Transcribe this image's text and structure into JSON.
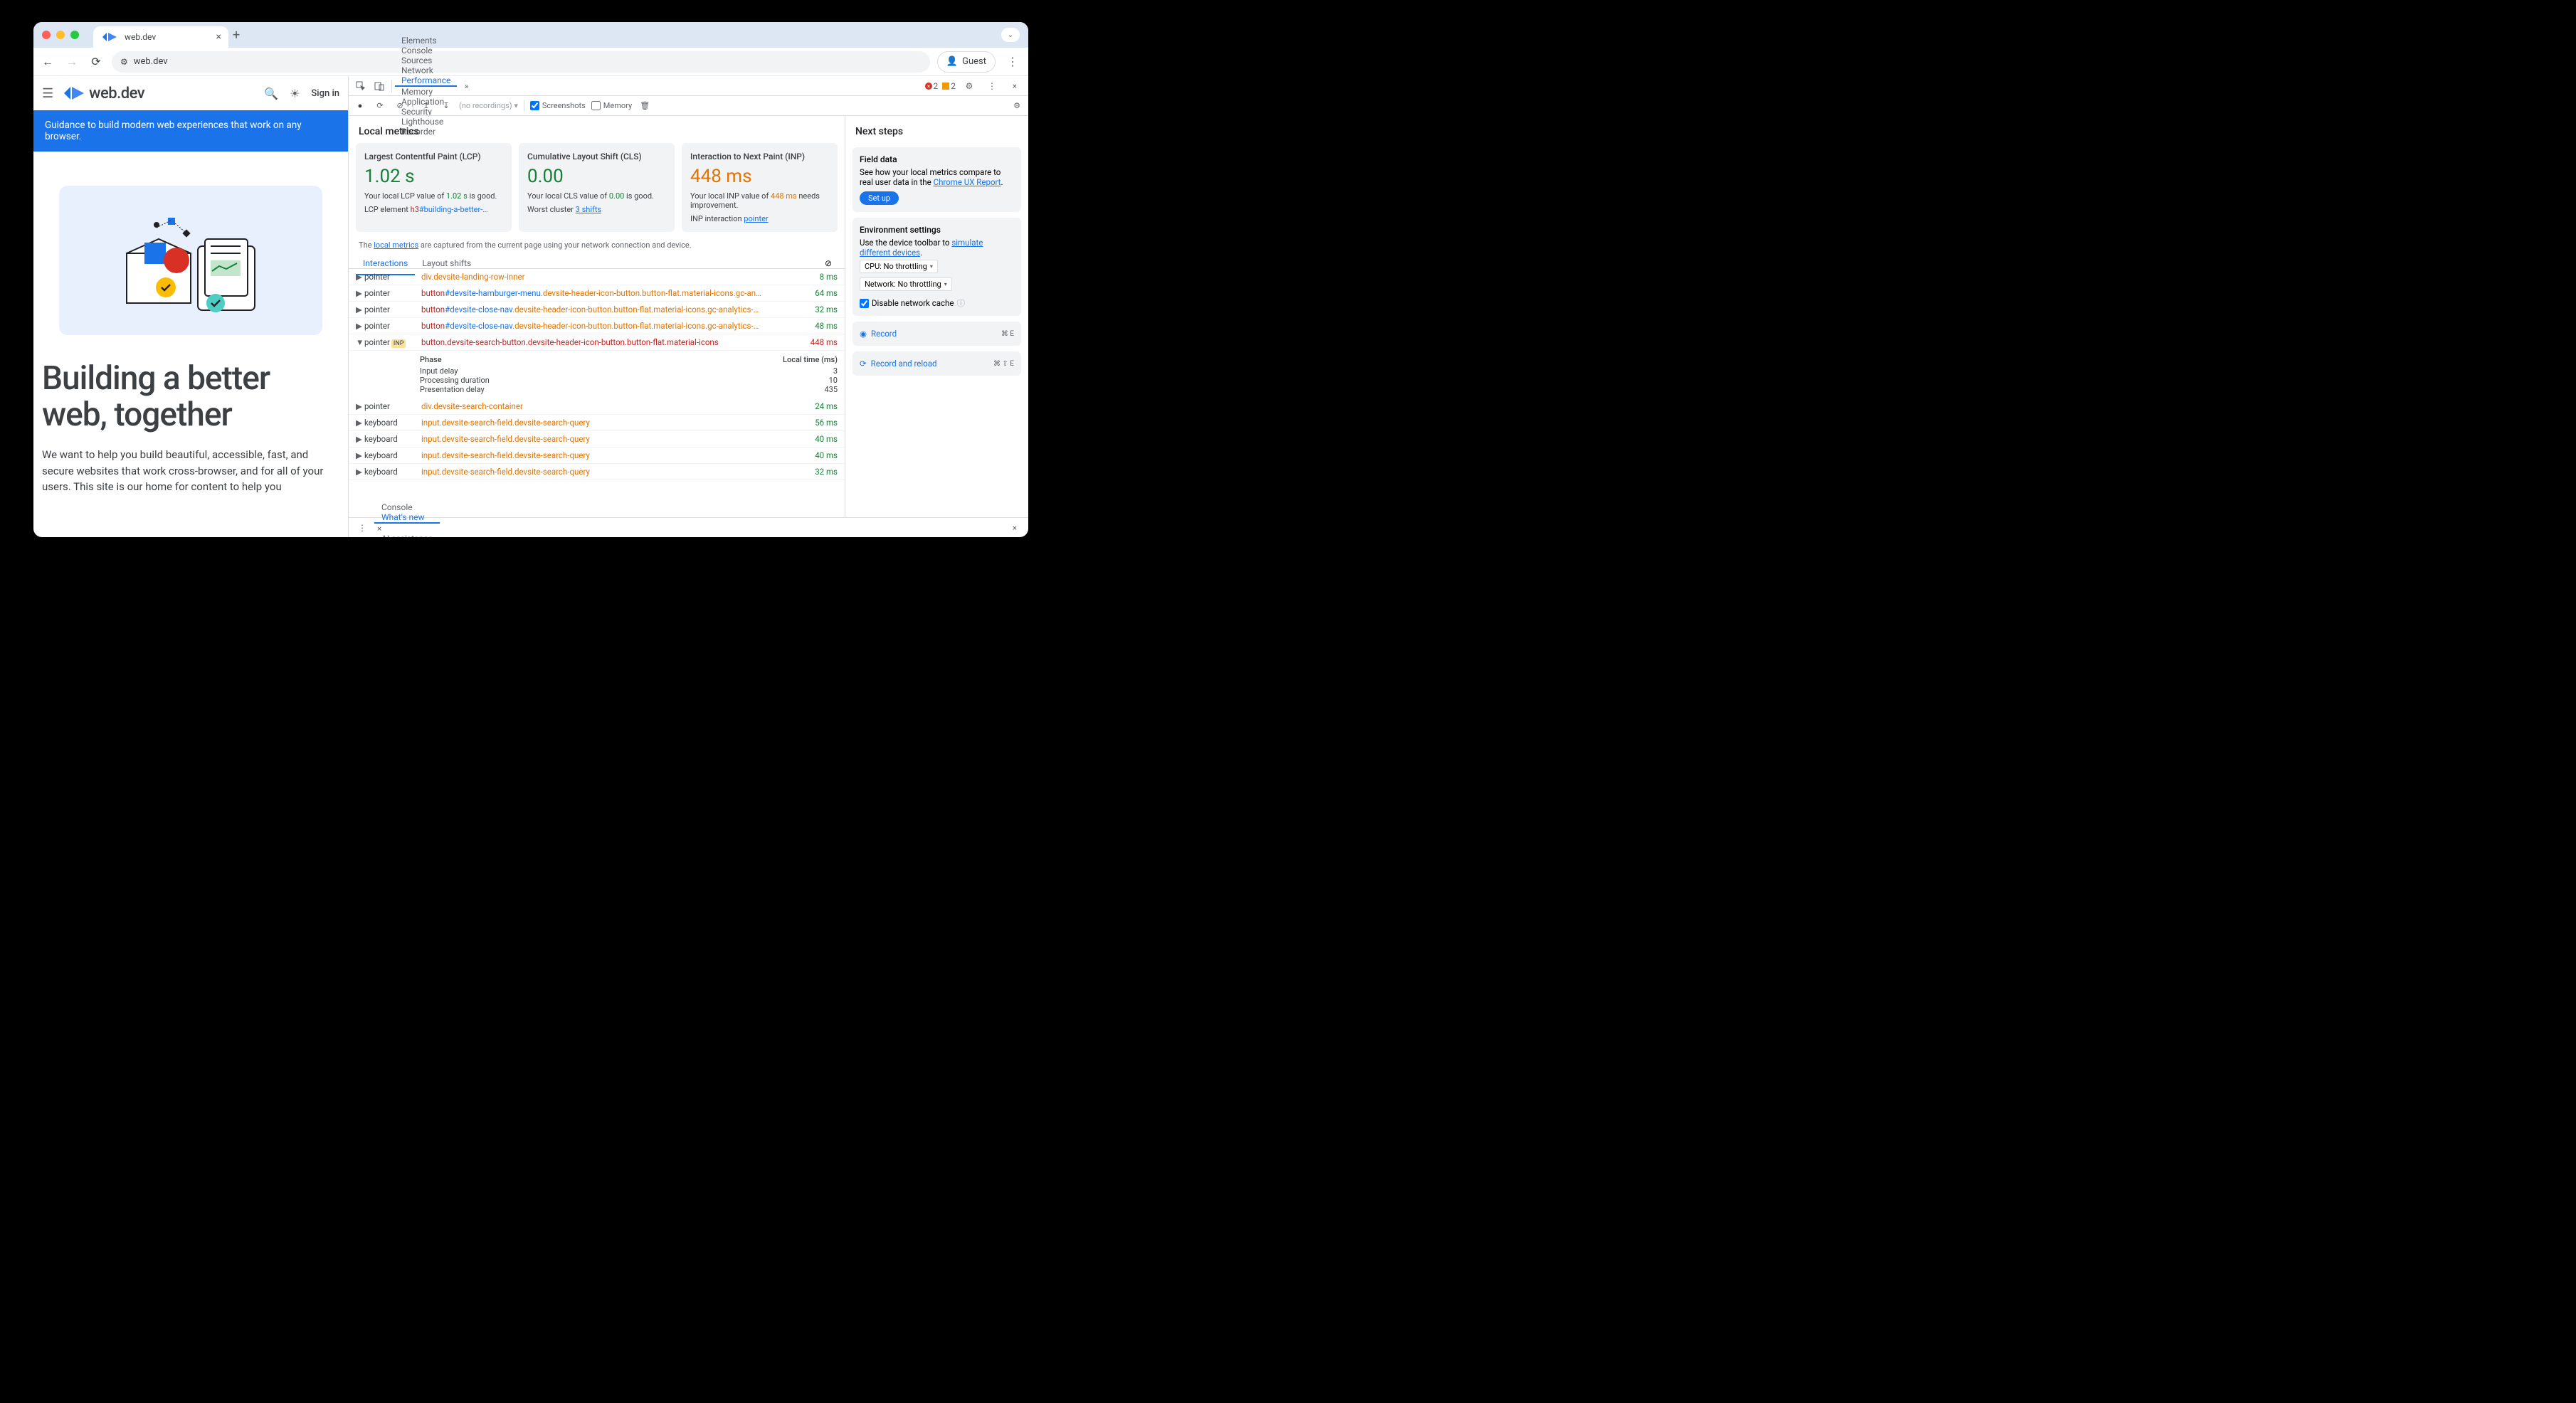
{
  "browser": {
    "tab_title": "web.dev",
    "url": "web.dev",
    "guest_label": "Guest"
  },
  "webdev": {
    "brand": "web.dev",
    "signin": "Sign in",
    "banner": "Guidance to build modern web experiences that work on any browser.",
    "hero_title": "Building a better web, together",
    "hero_body": "We want to help you build beautiful, accessible, fast, and secure websites that work cross-browser, and for all of your users. This site is our home for content to help you"
  },
  "devtools": {
    "tabs": [
      "Elements",
      "Console",
      "Sources",
      "Network",
      "Performance",
      "Memory",
      "Application",
      "Security",
      "Lighthouse",
      "Recorder"
    ],
    "active_tab": "Performance",
    "errors": "2",
    "warnings": "2",
    "toolbar": {
      "recordings": "(no recordings)",
      "screenshots_label": "Screenshots",
      "memory_label": "Memory"
    },
    "local_metrics_title": "Local metrics",
    "metrics": [
      {
        "title": "Largest Contentful Paint (LCP)",
        "value": "1.02 s",
        "cls": "good",
        "desc_pre": "Your local LCP value of ",
        "desc_val": "1.02 s",
        "desc_post": " is good.",
        "extra_label": "LCP element",
        "extra_tag": "h3",
        "extra_sel": "#building-a-better-…"
      },
      {
        "title": "Cumulative Layout Shift (CLS)",
        "value": "0.00",
        "cls": "good",
        "desc_pre": "Your local CLS value of ",
        "desc_val": "0.00",
        "desc_post": " is good.",
        "extra_label": "Worst cluster ",
        "extra_link": "3 shifts"
      },
      {
        "title": "Interaction to Next Paint (INP)",
        "value": "448 ms",
        "cls": "warn",
        "desc_pre": "Your local INP value of ",
        "desc_val": "448 ms",
        "desc_post": " needs improvement.",
        "extra_label": "INP interaction ",
        "extra_link": "pointer"
      }
    ],
    "info_pre": "The ",
    "info_link": "local metrics",
    "info_post": " are captured from the current page using your network connection and device.",
    "subtabs": [
      "Interactions",
      "Layout shifts"
    ],
    "phase": {
      "header_l": "Phase",
      "header_r": "Local time (ms)",
      "rows": [
        {
          "l": "Input delay",
          "r": "3"
        },
        {
          "l": "Processing duration",
          "r": "10"
        },
        {
          "l": "Presentation delay",
          "r": "435"
        }
      ]
    },
    "interactions": [
      {
        "type": "pointer",
        "sel": [
          [
            "cls",
            "div.devsite-landing-row-inner"
          ]
        ],
        "time": "8 ms"
      },
      {
        "type": "pointer",
        "sel": [
          [
            "tag",
            "button"
          ],
          [
            "id",
            "#devsite-hamburger-menu"
          ],
          [
            "cls",
            ".devsite-header-icon-button.button-flat.material-icons.gc-an…"
          ]
        ],
        "time": "64 ms"
      },
      {
        "type": "pointer",
        "sel": [
          [
            "tag",
            "button"
          ],
          [
            "id",
            "#devsite-close-nav"
          ],
          [
            "cls",
            ".devsite-header-icon-button.button-flat.material-icons.gc-analytics-…"
          ]
        ],
        "time": "32 ms"
      },
      {
        "type": "pointer",
        "sel": [
          [
            "tag",
            "button"
          ],
          [
            "id",
            "#devsite-close-nav"
          ],
          [
            "cls",
            ".devsite-header-icon-button.button-flat.material-icons.gc-analytics-…"
          ]
        ],
        "time": "48 ms"
      },
      {
        "type": "pointer",
        "inp": true,
        "expanded": true,
        "sel": [
          [
            "tag",
            "button.devsite-search-button.devsite-header-icon-button.button-flat.material-icons"
          ]
        ],
        "time": "448 ms"
      },
      {
        "type": "pointer",
        "sel": [
          [
            "cls",
            "div.devsite-search-container"
          ]
        ],
        "time": "24 ms"
      },
      {
        "type": "keyboard",
        "sel": [
          [
            "cls",
            "input.devsite-search-field.devsite-search-query"
          ]
        ],
        "time": "56 ms"
      },
      {
        "type": "keyboard",
        "sel": [
          [
            "cls",
            "input.devsite-search-field.devsite-search-query"
          ]
        ],
        "time": "40 ms"
      },
      {
        "type": "keyboard",
        "sel": [
          [
            "cls",
            "input.devsite-search-field.devsite-search-query"
          ]
        ],
        "time": "40 ms"
      },
      {
        "type": "keyboard",
        "sel": [
          [
            "cls",
            "input.devsite-search-field.devsite-search-query"
          ]
        ],
        "time": "32 ms"
      }
    ],
    "next_steps_title": "Next steps",
    "field": {
      "title": "Field data",
      "body_pre": "See how your local metrics compare to real user data in the ",
      "body_link": "Chrome UX Report",
      "button": "Set up"
    },
    "env": {
      "title": "Environment settings",
      "body_pre": "Use the device toolbar to ",
      "body_link": "simulate different devices",
      "cpu": "CPU: No throttling",
      "net": "Network: No throttling",
      "cache": "Disable network cache"
    },
    "record": {
      "label": "Record",
      "shortcut": "⌘ E"
    },
    "record_reload": {
      "label": "Record and reload",
      "shortcut": "⌘ ⇧ E"
    },
    "drawer": {
      "tabs": [
        "Console",
        "What's new",
        "AI assistance"
      ],
      "active": "What's new"
    }
  }
}
